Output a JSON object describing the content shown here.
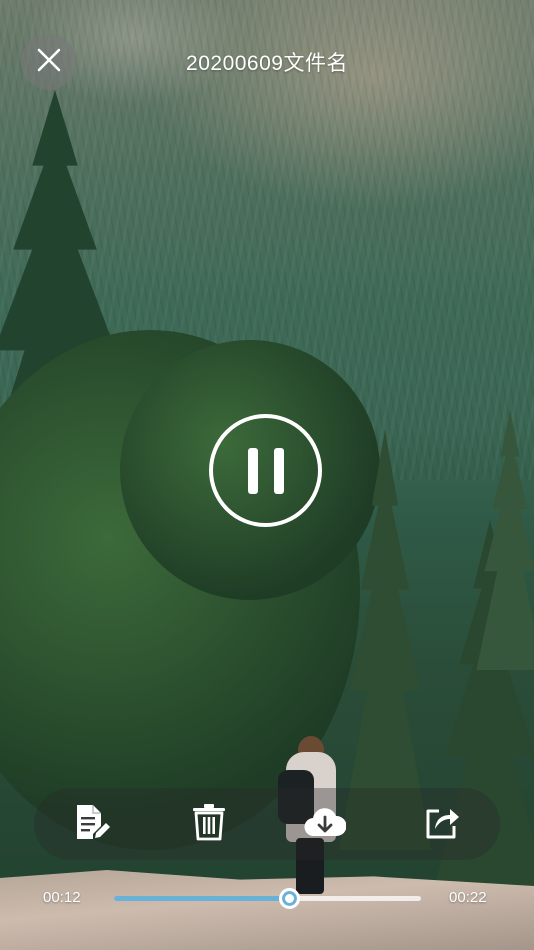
{
  "player": {
    "title": "20200609文件名",
    "state": "playing",
    "current_time": "00:12",
    "total_time": "00:22",
    "progress": 0.57
  },
  "icons": {
    "close": "close-icon",
    "pause": "pause-icon",
    "edit": "edit-document-icon",
    "delete": "trash-icon",
    "download": "cloud-download-icon",
    "share": "share-icon"
  },
  "colors": {
    "accent": "#6ab1d8",
    "overlay": "rgba(40,40,40,0.35)"
  }
}
